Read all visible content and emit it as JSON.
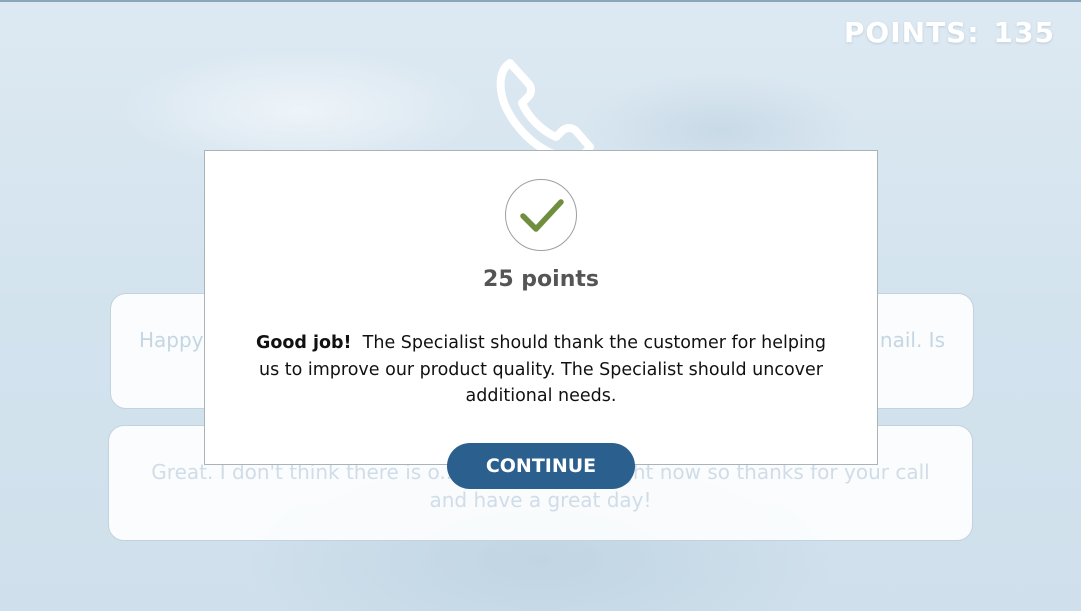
{
  "header": {
    "points_label": "POINTS:",
    "points_value": "135"
  },
  "options": [
    {
      "text_left": "Happy",
      "text_right": "nail. Is"
    },
    {
      "text": "Great. I don't think there is o... help you with right now so thanks for your call and have a great day!"
    }
  ],
  "modal": {
    "status_icon": "checkmark-icon",
    "points_text": "25 points",
    "feedback_bold": "Good job!",
    "feedback_text": "The Specialist should thank the customer for helping us to improve our product quality. The Specialist should uncover additional needs.",
    "continue_label": "CONTINUE"
  },
  "colors": {
    "accent": "#2b5f8e",
    "check": "#6f8f3e",
    "background": "#d6e6f1"
  }
}
